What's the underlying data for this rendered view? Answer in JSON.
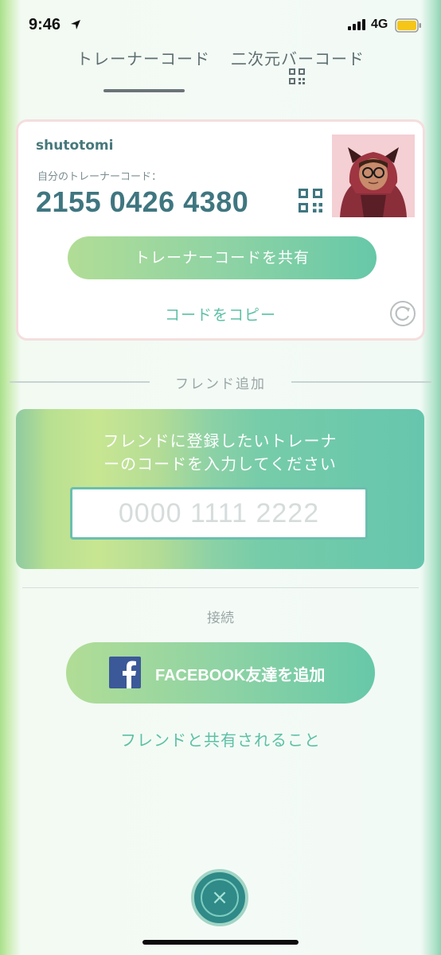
{
  "status_bar": {
    "time": "9:46",
    "network": "4G"
  },
  "tabs": [
    {
      "label": "トレーナーコード",
      "active": true
    },
    {
      "label": "二次元バーコード",
      "active": false
    }
  ],
  "profile_card": {
    "username": "shutotomi",
    "code_label": "自分のトレーナーコード：",
    "trainer_code": "2155 0426 4380",
    "share_button": "トレーナーコードを共有",
    "copy_link": "コードをコピー"
  },
  "friend_add": {
    "section_label": "フレンド追加",
    "prompt_line1": "フレンドに登録したいトレーナ",
    "prompt_line2": "ーのコードを入力してください",
    "input_placeholder": "0000 1111 2222"
  },
  "connect": {
    "section_label": "接続",
    "facebook_button": "FACEBOOK友達を追加",
    "share_link": "フレンドと共有されること"
  },
  "close_glyph": "×",
  "colors": {
    "accent": "#5cc0a5",
    "code_text": "#3f7680",
    "close_bg": "#2f8a88",
    "facebook": "#3b5998"
  }
}
